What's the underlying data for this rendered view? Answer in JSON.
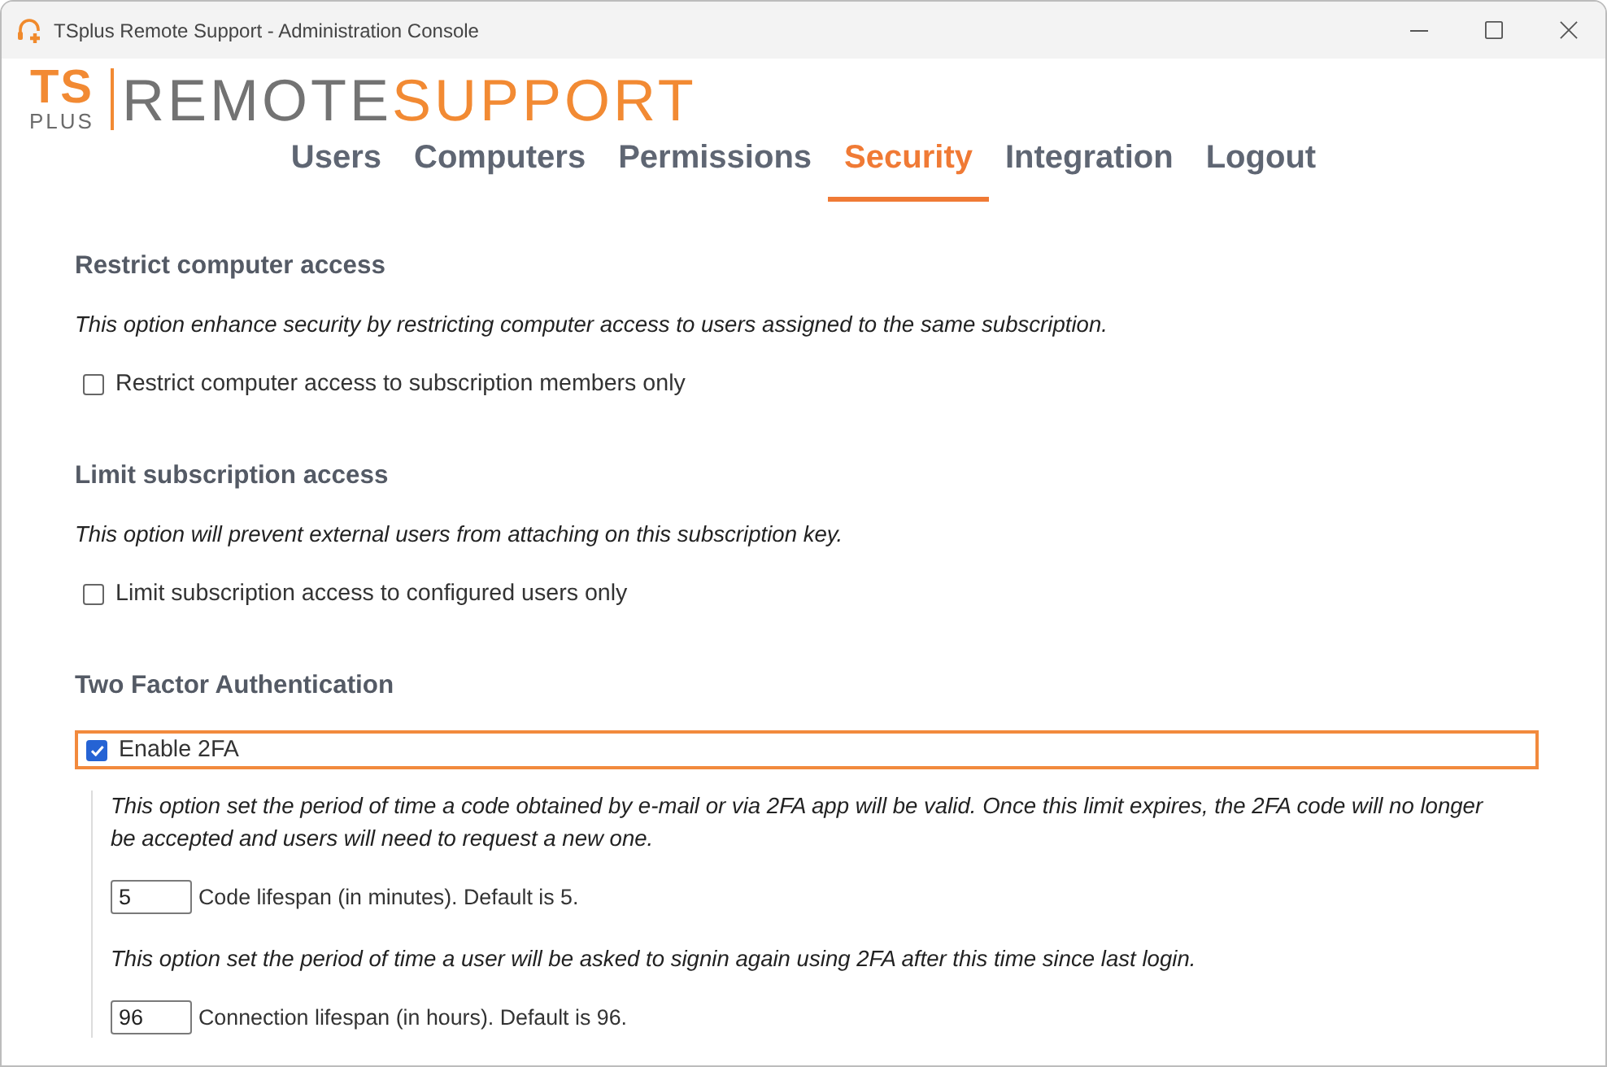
{
  "window": {
    "title": "TSplus Remote Support - Administration Console"
  },
  "logo": {
    "ts": "TS",
    "plus": "PLUS",
    "remote": "REMOTE",
    "support": "SUPPORT"
  },
  "tabs": [
    {
      "label": "Users",
      "selected": false
    },
    {
      "label": "Computers",
      "selected": false
    },
    {
      "label": "Permissions",
      "selected": false
    },
    {
      "label": "Security",
      "selected": true
    },
    {
      "label": "Integration",
      "selected": false
    },
    {
      "label": "Logout",
      "selected": false
    }
  ],
  "sections": [
    {
      "heading": "Restrict computer access",
      "items": [
        {
          "kind": "note",
          "text": "This option enhance security by restricting computer access to users assigned to the same subscription."
        },
        {
          "kind": "checkbox",
          "label": "Restrict computer access to subscription members only",
          "checked": false,
          "focused": false
        }
      ]
    },
    {
      "heading": "Limit subscription access",
      "items": [
        {
          "kind": "note",
          "text": "This option will prevent external users from attaching on this subscription key."
        },
        {
          "kind": "checkbox",
          "label": "Limit subscription access to configured users only",
          "checked": false,
          "focused": false
        }
      ]
    },
    {
      "heading": "Two Factor Authentication",
      "items": [
        {
          "kind": "checkbox",
          "label": "Enable 2FA",
          "checked": true,
          "focused": true,
          "children": [
            {
              "kind": "note",
              "text": "This option set the period of time a code obtained by e-mail or via 2FA app will be valid. Once this limit expires, the 2FA code will no longer be accepted and users will need to request a new one."
            },
            {
              "kind": "number",
              "value": "5",
              "label": "Code lifespan (in minutes). Default is 5."
            },
            {
              "kind": "note",
              "text": "This option set the period of time a user will be asked to signin again using 2FA after this time since last login."
            },
            {
              "kind": "number",
              "value": "96",
              "label": "Connection lifespan (in hours). Default is 96."
            }
          ]
        }
      ]
    }
  ]
}
